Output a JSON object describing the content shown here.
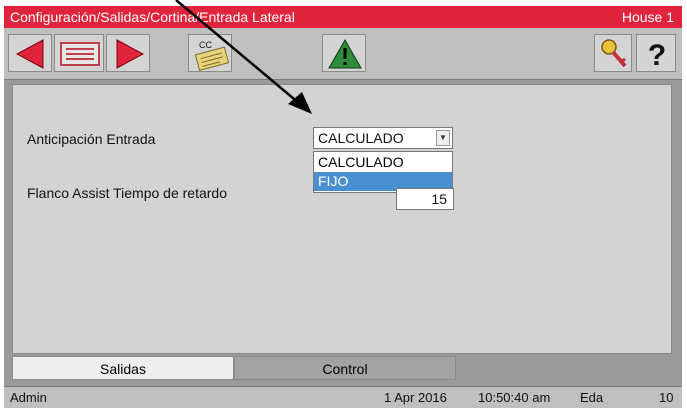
{
  "titlebar": {
    "path": "Configuración/Salidas/Cortina/Entrada Lateral",
    "house": "House 1"
  },
  "toolbar": {
    "cc_label": "CC",
    "help_label": "?"
  },
  "form": {
    "anticipacion_label": "Anticipación Entrada",
    "anticipacion_value": "CALCULADO",
    "anticipacion_options": [
      "CALCULADO",
      "FIJO"
    ],
    "anticipacion_highlighted": "FIJO",
    "flanco_label": "Flanco Assist Tiempo de retardo",
    "flanco_value": "15"
  },
  "tabs": [
    {
      "label": "Salidas",
      "active": true
    },
    {
      "label": "Control",
      "active": false
    }
  ],
  "statusbar": {
    "user": "Admin",
    "date": "1 Apr 2016",
    "time": "10:50:40 am",
    "mode": "Eda",
    "number": "10"
  },
  "colors": {
    "titlebar": "#e0243c",
    "nav_arrow": "#e0243c",
    "alarm_triangle": "#2e8b3a",
    "selection": "#4a90d0"
  },
  "icons": [
    "arrow-left-icon",
    "program-list-icon",
    "arrow-right-icon",
    "cc-card-icon",
    "alarm-warning-icon",
    "key-icon",
    "help-icon"
  ]
}
